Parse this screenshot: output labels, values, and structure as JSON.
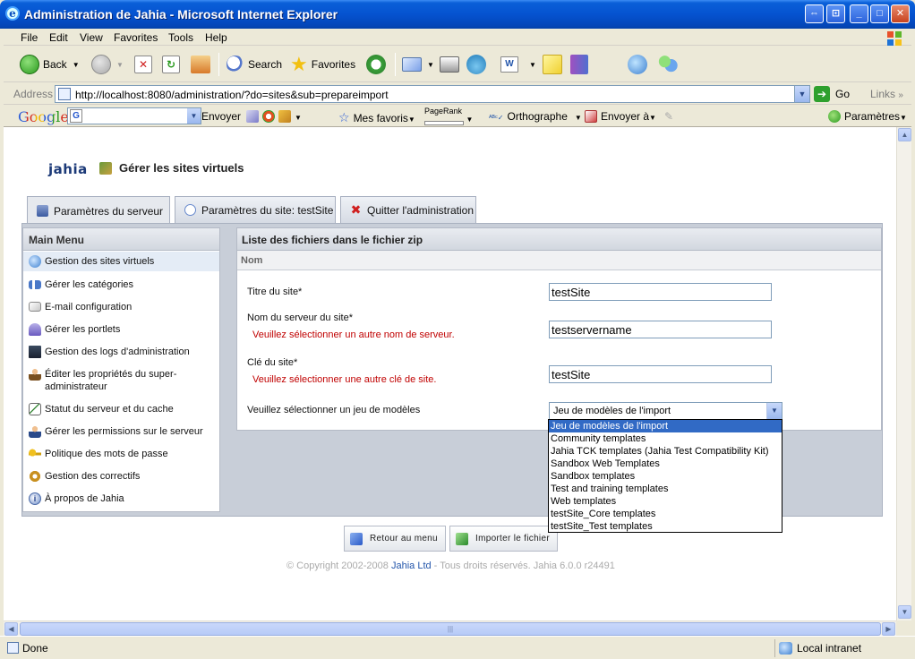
{
  "window": {
    "title": "Administration de Jahia - Microsoft Internet Explorer"
  },
  "menubar": [
    "File",
    "Edit",
    "View",
    "Favorites",
    "Tools",
    "Help"
  ],
  "toolbar": {
    "back": "Back",
    "search": "Search",
    "favorites": "Favorites"
  },
  "address": {
    "label": "Address",
    "url": "http://localhost:8080/administration/?do=sites&sub=prepareimport",
    "go": "Go",
    "links": "Links"
  },
  "googlebar": {
    "logo": "Google",
    "envoyer": "Envoyer",
    "mes_favoris": "Mes favoris",
    "pagerank": "PageRank",
    "orthographe": "Orthographe",
    "envoyer_a": "Envoyer à",
    "parametres": "Paramètres"
  },
  "jahia": {
    "logo": "jahia",
    "page_title": "Gérer les sites virtuels",
    "tabs": [
      {
        "label": "Paramètres du serveur",
        "active": true
      },
      {
        "label": "Paramètres du site: testSite",
        "active": false
      },
      {
        "label": "Quitter l'administration",
        "active": false
      }
    ],
    "main_menu": {
      "title": "Main Menu",
      "items": [
        {
          "label": "Gestion des sites virtuels",
          "icon": "globe-icon",
          "selected": true
        },
        {
          "label": "Gérer les catégories",
          "icon": "categories-icon"
        },
        {
          "label": "E-mail configuration",
          "icon": "envelope-icon"
        },
        {
          "label": "Gérer les portlets",
          "icon": "portlet-icon"
        },
        {
          "label": "Gestion des logs d'administration",
          "icon": "monitor-icon"
        },
        {
          "label": "Éditer les propriétés du super-administrateur",
          "icon": "user-icon"
        },
        {
          "label": "Statut du serveur et du cache",
          "icon": "chart-icon"
        },
        {
          "label": "Gérer les permissions sur le serveur",
          "icon": "user-lock-icon"
        },
        {
          "label": "Politique des mots de passe",
          "icon": "key-icon"
        },
        {
          "label": "Gestion des correctifs",
          "icon": "patch-icon"
        },
        {
          "label": "À propos de Jahia",
          "icon": "info-icon"
        }
      ]
    },
    "content": {
      "header": "Liste des fichiers dans le fichier zip",
      "column": "Nom",
      "fields": {
        "site_title_label": "Titre du site*",
        "site_title_value": "testSite",
        "server_name_label": "Nom du serveur du site*",
        "server_name_error": "Veuillez sélectionner un autre nom de serveur.",
        "server_name_value": "testservername",
        "site_key_label": "Clé du site*",
        "site_key_error": "Veuillez sélectionner une autre clé de site.",
        "site_key_value": "testSite",
        "template_label": "Veuillez sélectionner un jeu de modèles",
        "template_selected": "Jeu de modèles de l'import"
      },
      "template_options": [
        "Jeu de modèles de l'import",
        "Community templates",
        "Jahia TCK templates (Jahia Test Compatibility Kit)",
        "Sandbox Web Templates",
        "Sandbox templates",
        "Test and training templates",
        "Web templates",
        "testSite_Core templates",
        "testSite_Test templates"
      ]
    },
    "buttons": {
      "back": "Retour au menu",
      "import": "Importer le fichier"
    },
    "copyright": {
      "prefix": "© Copyright 2002-2008 ",
      "link": "Jahia Ltd",
      "suffix": " - Tous droits réservés. Jahia 6.0.0 r24491"
    }
  },
  "status": {
    "text": "Done",
    "zone": "Local intranet"
  }
}
